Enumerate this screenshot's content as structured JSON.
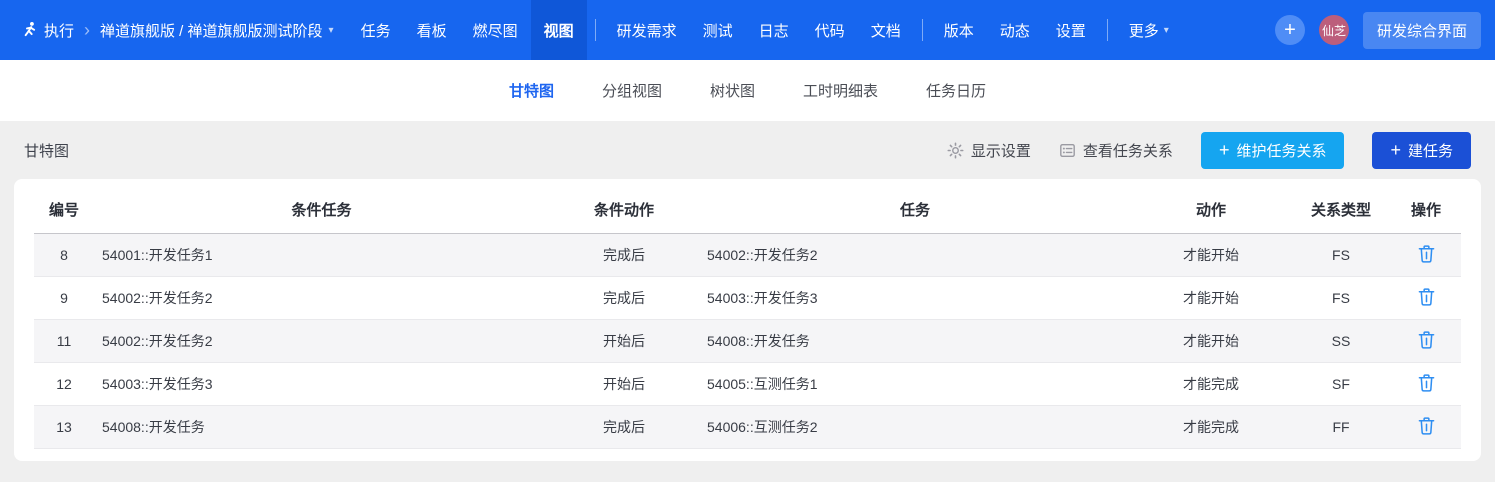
{
  "topbar": {
    "module": "执行",
    "project": "禅道旗舰版 / 禅道旗舰版测试阶段",
    "nav": {
      "tasks": "任务",
      "kanban": "看板",
      "burndown": "燃尽图",
      "views": "视图",
      "stories": "研发需求",
      "test": "测试",
      "logs": "日志",
      "code": "代码",
      "docs": "文档",
      "builds": "版本",
      "dynamics": "动态",
      "settings": "设置",
      "more": "更多"
    },
    "active_nav": "视图",
    "avatar_text": "仙芝",
    "workbench_button": "研发综合界面"
  },
  "tabs": {
    "items": [
      "甘特图",
      "分组视图",
      "树状图",
      "工时明细表",
      "任务日历"
    ],
    "active": "甘特图"
  },
  "toolbar": {
    "title": "甘特图",
    "display_settings": "显示设置",
    "view_relations": "查看任务关系",
    "plus": "+",
    "maintain_relations": "维护任务关系",
    "create_task": "建任务"
  },
  "table": {
    "headers": {
      "id": "编号",
      "pre_task": "条件任务",
      "pre_action": "条件动作",
      "task": "任务",
      "action": "动作",
      "type": "关系类型",
      "ops": "操作"
    },
    "rows": [
      {
        "id": "8",
        "pre_task": "54001::开发任务1",
        "pre_action": "完成后",
        "task": "54002::开发任务2",
        "action": "才能开始",
        "type": "FS"
      },
      {
        "id": "9",
        "pre_task": "54002::开发任务2",
        "pre_action": "完成后",
        "task": "54003::开发任务3",
        "action": "才能开始",
        "type": "FS"
      },
      {
        "id": "11",
        "pre_task": "54002::开发任务2",
        "pre_action": "开始后",
        "task": "54008::开发任务",
        "action": "才能开始",
        "type": "SS"
      },
      {
        "id": "12",
        "pre_task": "54003::开发任务3",
        "pre_action": "开始后",
        "task": "54005::互测任务1",
        "action": "才能完成",
        "type": "SF"
      },
      {
        "id": "13",
        "pre_task": "54008::开发任务",
        "pre_action": "完成后",
        "task": "54006::互测任务2",
        "action": "才能完成",
        "type": "FF"
      }
    ]
  },
  "colors": {
    "topbar_blue": "#1766ef",
    "topbar_active_blue": "#0f57d8",
    "tab_active_blue": "#1f66f0",
    "maintain_button_blue": "#15a5f0",
    "create_button_blue": "#1b50d6",
    "trash_icon_blue": "#2e8ef2",
    "avatar_rose": "#bc5e7c",
    "page_background": "#efefef"
  }
}
